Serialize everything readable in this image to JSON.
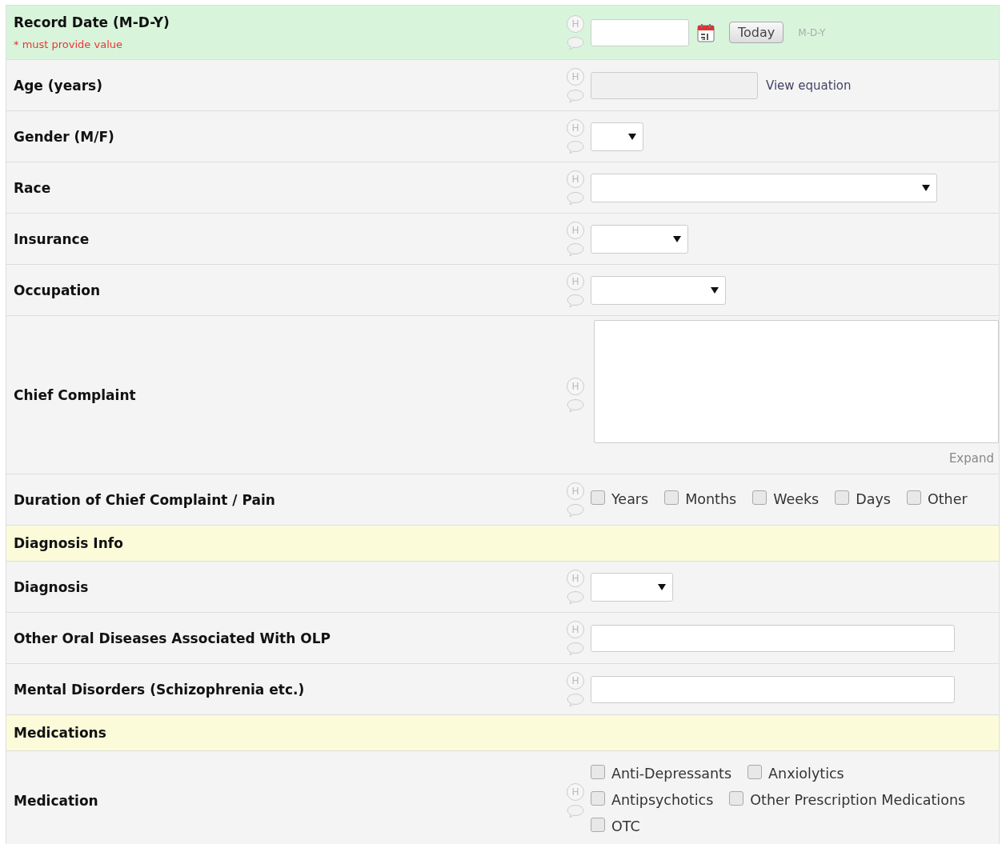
{
  "rows": [
    {
      "kind": "date",
      "label": "Record Date (M-D-Y)",
      "required": "* must provide value",
      "highlighted": true,
      "history": "H",
      "value": "",
      "button": "Today",
      "format": "M-D-Y"
    },
    {
      "kind": "calc",
      "label": "Age (years)",
      "highlighted": false,
      "history": "H",
      "value": "",
      "link": "View equation"
    },
    {
      "kind": "select",
      "label": "Gender (M/F)",
      "highlighted": false,
      "history": "H"
    },
    {
      "kind": "select",
      "label": "Race",
      "highlighted": false,
      "history": "H"
    },
    {
      "kind": "select",
      "label": "Insurance",
      "highlighted": false,
      "history": "H"
    },
    {
      "kind": "select",
      "label": "Occupation",
      "highlighted": false,
      "history": "H"
    },
    {
      "kind": "textarea",
      "label": "Chief Complaint",
      "highlighted": false,
      "history": "H",
      "value": "",
      "link": "Expand"
    },
    {
      "kind": "checkboxes",
      "label": "Duration of Chief Complaint / Pain",
      "highlighted": false,
      "history": "H",
      "options": [
        {
          "label": "Years",
          "checked": false
        },
        {
          "label": "Months",
          "checked": false
        },
        {
          "label": "Weeks",
          "checked": false
        },
        {
          "label": "Days",
          "checked": false
        },
        {
          "label": "Other",
          "checked": false
        }
      ]
    },
    {
      "kind": "header",
      "label": "Diagnosis Info"
    },
    {
      "kind": "select",
      "label": "Diagnosis",
      "highlighted": false,
      "history": "H"
    },
    {
      "kind": "text",
      "label": "Other Oral Diseases Associated With OLP",
      "highlighted": false,
      "history": "H",
      "value": ""
    },
    {
      "kind": "text",
      "label": "Mental Disorders (Schizophrenia etc.)",
      "highlighted": false,
      "history": "H",
      "value": ""
    },
    {
      "kind": "header",
      "label": "Medications"
    },
    {
      "kind": "checkboxes",
      "label": "Medication",
      "highlighted": false,
      "history": "H",
      "options": [
        {
          "label": "Anti-Depressants",
          "checked": false
        },
        {
          "label": "Anxiolytics",
          "checked": false
        },
        {
          "label": "Antipsychotics",
          "checked": false
        },
        {
          "label": "Other Prescription Medications",
          "checked": false
        },
        {
          "label": "OTC",
          "checked": false
        }
      ]
    }
  ]
}
